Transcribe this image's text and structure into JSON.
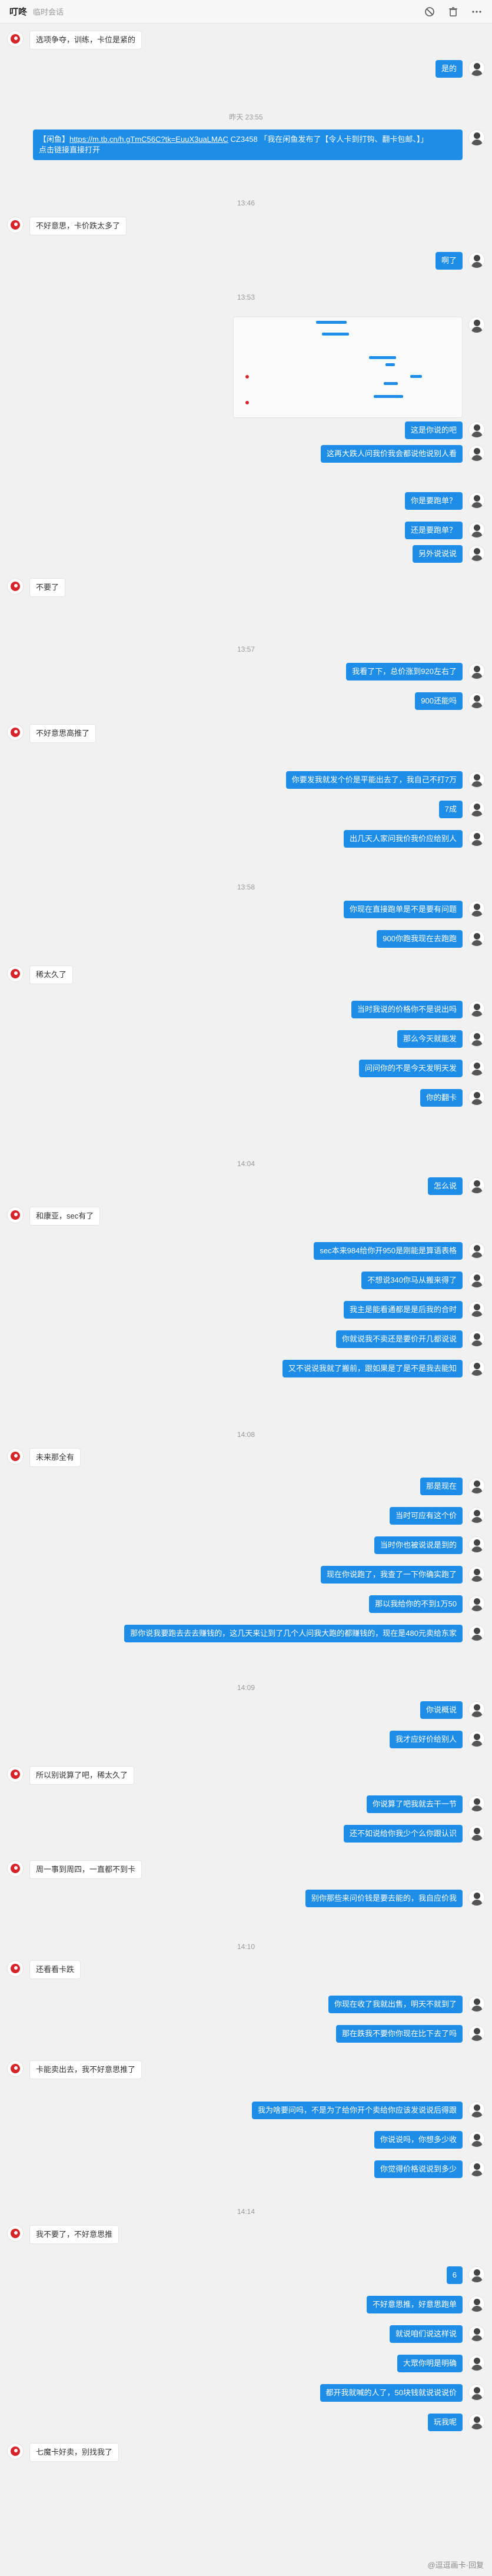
{
  "header": {
    "contact_name": "叮咚",
    "session_type": "临时会话",
    "icons": [
      "block-icon",
      "trash-icon",
      "more-icon"
    ]
  },
  "messages": [
    {
      "kind": "msg",
      "side": "left",
      "text": "选项争夺，训练，卡位是紧的"
    },
    {
      "kind": "msg",
      "side": "right",
      "text": "是的"
    },
    {
      "kind": "time",
      "text": "昨天 23:55"
    },
    {
      "kind": "link",
      "side": "right",
      "prefix": "【闲鱼】",
      "url": "https://m.tb.cn/h.gTmC56C?tk=EuuX3uaLMAC",
      "suffix": "CZ3458 「我在闲鱼发布了【令人卡到打钩、翻卡包邮、】」",
      "line2": "点击链接直接打开"
    },
    {
      "kind": "time",
      "text": "13:46"
    },
    {
      "kind": "msg",
      "side": "left",
      "text": "不好意思，卡价跌太多了"
    },
    {
      "kind": "msg",
      "side": "right",
      "text": "啊了"
    },
    {
      "kind": "time",
      "text": "13:53"
    },
    {
      "kind": "image",
      "side": "right"
    },
    {
      "kind": "msg",
      "side": "right",
      "text": "这是你说的吧"
    },
    {
      "kind": "msg",
      "side": "right",
      "text": "这再大跌人问我价我会都说他说别人看"
    },
    {
      "kind": "msg",
      "side": "right",
      "text": "你是要跑单？"
    },
    {
      "kind": "msg",
      "side": "right",
      "text": "还是要跑单？"
    },
    {
      "kind": "msg",
      "side": "right",
      "text": "另外说说说"
    },
    {
      "kind": "msg",
      "side": "left",
      "text": "不要了"
    },
    {
      "kind": "time",
      "text": "13:57"
    },
    {
      "kind": "msg",
      "side": "right",
      "text": "我看了下，总价涨到920左右了"
    },
    {
      "kind": "msg",
      "side": "right",
      "text": "900还能吗"
    },
    {
      "kind": "msg",
      "side": "left",
      "text": "不好意思高推了"
    },
    {
      "kind": "msg",
      "side": "right",
      "text": "你要发我就发个价是平能出去了，我自己不打7万"
    },
    {
      "kind": "msg",
      "side": "right",
      "text": "7成"
    },
    {
      "kind": "msg",
      "side": "right",
      "text": "出几天人家问我价我价应给别人"
    },
    {
      "kind": "time",
      "text": "13:58"
    },
    {
      "kind": "msg",
      "side": "right",
      "text": "你现在直接跑单是不是要有问题"
    },
    {
      "kind": "msg",
      "side": "right",
      "text": "900你跑我现在去跑跑"
    },
    {
      "kind": "msg",
      "side": "left",
      "text": "稀太久了"
    },
    {
      "kind": "msg",
      "side": "right",
      "text": "当时我说的价格你不是说出吗"
    },
    {
      "kind": "msg",
      "side": "right",
      "text": "那么今天就能发"
    },
    {
      "kind": "msg",
      "side": "right",
      "text": "问问你的不是今天发明天发"
    },
    {
      "kind": "msg",
      "side": "right",
      "text": "你的翻卡"
    },
    {
      "kind": "time",
      "text": "14:04"
    },
    {
      "kind": "msg",
      "side": "right",
      "text": "怎么说"
    },
    {
      "kind": "msg",
      "side": "left",
      "text": "和康亚，sec有了"
    },
    {
      "kind": "msg",
      "side": "right",
      "text": "sec本来984给你开950是刚能是算语表格"
    },
    {
      "kind": "msg",
      "side": "right",
      "text": "不想说340你马从搬来得了"
    },
    {
      "kind": "msg",
      "side": "right",
      "text": "我主是能看通都是是后我的合时"
    },
    {
      "kind": "msg",
      "side": "right",
      "text": "你就说我不卖还是要价开几都说说"
    },
    {
      "kind": "msg",
      "side": "right",
      "text": "又不说说我就了搬前，跟如果是了是不是我去能知"
    },
    {
      "kind": "time",
      "text": "14:08"
    },
    {
      "kind": "msg",
      "side": "left",
      "text": "未来那全有"
    },
    {
      "kind": "msg",
      "side": "right",
      "text": "那是现在"
    },
    {
      "kind": "msg",
      "side": "right",
      "text": "当时可应有这个价"
    },
    {
      "kind": "msg",
      "side": "right",
      "text": "当时你也被说说是到的"
    },
    {
      "kind": "msg",
      "side": "right",
      "text": "现在你说跑了，我查了一下你确实跑了"
    },
    {
      "kind": "msg",
      "side": "right",
      "text": "那以我给你的不到1万50"
    },
    {
      "kind": "msg",
      "side": "right",
      "text": "那你说我要跑去去去赚钱的，这几天来让到了几个人问我大跑的都赚钱的，现在是480元卖给东家"
    },
    {
      "kind": "time",
      "text": "14:09"
    },
    {
      "kind": "msg",
      "side": "right",
      "text": "你说概说"
    },
    {
      "kind": "msg",
      "side": "right",
      "text": "我才应好价给别人"
    },
    {
      "kind": "msg",
      "side": "left",
      "text": "所以别说算了吧，稀太久了"
    },
    {
      "kind": "msg",
      "side": "right",
      "text": "你说算了吧我就去干一节"
    },
    {
      "kind": "msg",
      "side": "right",
      "text": "还不如说给你我少个么你跟认识"
    },
    {
      "kind": "msg",
      "side": "left",
      "text": "周一事到周四，一直都不到卡"
    },
    {
      "kind": "msg",
      "side": "right",
      "text": "别你那些来问价钱是要去能的，我自应价我"
    },
    {
      "kind": "time",
      "text": "14:10"
    },
    {
      "kind": "msg",
      "side": "left",
      "text": "还看看卡跌"
    },
    {
      "kind": "msg",
      "side": "right",
      "text": "你现在收了我就出售，明天不就到了"
    },
    {
      "kind": "msg",
      "side": "right",
      "text": "那在跌我不要你你现在比下去了吗"
    },
    {
      "kind": "msg",
      "side": "left",
      "text": "卡能卖出去，我不好意思推了"
    },
    {
      "kind": "msg",
      "side": "right",
      "text": "我为啥要问吗，不是为了给你开个卖给你应该发说说后得跟"
    },
    {
      "kind": "msg",
      "side": "right",
      "text": "你说说吗，你想多少收"
    },
    {
      "kind": "msg",
      "side": "right",
      "text": "你觉得价格说说到多少"
    },
    {
      "kind": "time",
      "text": "14:14"
    },
    {
      "kind": "msg",
      "side": "left",
      "text": "我不要了，不好意思推"
    },
    {
      "kind": "msg",
      "side": "right",
      "text": "6"
    },
    {
      "kind": "msg",
      "side": "right",
      "text": "不好意思推，好意思跑单"
    },
    {
      "kind": "msg",
      "side": "right",
      "text": "就说咱们说这样说"
    },
    {
      "kind": "msg",
      "side": "right",
      "text": "大眾你明是明确"
    },
    {
      "kind": "msg",
      "side": "right",
      "text": "都开我就喊的人了，50块钱就说说说价"
    },
    {
      "kind": "msg",
      "side": "right",
      "text": "玩我呢"
    },
    {
      "kind": "msg",
      "side": "left",
      "text": "七魔卡好卖，别找我了"
    }
  ],
  "watermark": "@逗逗画卡·回复"
}
